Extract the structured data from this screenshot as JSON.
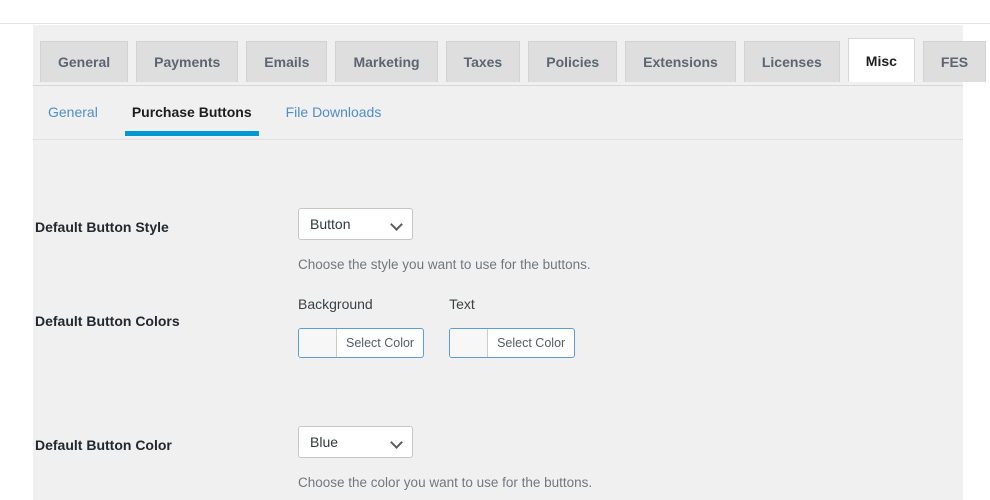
{
  "tabs": [
    {
      "label": "General",
      "active": false
    },
    {
      "label": "Payments",
      "active": false
    },
    {
      "label": "Emails",
      "active": false
    },
    {
      "label": "Marketing",
      "active": false
    },
    {
      "label": "Taxes",
      "active": false
    },
    {
      "label": "Policies",
      "active": false
    },
    {
      "label": "Extensions",
      "active": false
    },
    {
      "label": "Licenses",
      "active": false
    },
    {
      "label": "Misc",
      "active": true
    },
    {
      "label": "FES",
      "active": false
    }
  ],
  "subtabs": [
    {
      "label": "General",
      "active": false
    },
    {
      "label": "Purchase Buttons",
      "active": true
    },
    {
      "label": "File Downloads",
      "active": false
    }
  ],
  "settings": {
    "button_style": {
      "label": "Default Button Style",
      "value": "Button",
      "help": "Choose the style you want to use for the buttons.",
      "chevron_icon": "chevron-down-icon"
    },
    "button_colors": {
      "label": "Default Button Colors",
      "pickers": [
        {
          "caption": "Background",
          "button_label": "Select Color",
          "swatch_color": "#f7f7f7"
        },
        {
          "caption": "Text",
          "button_label": "Select Color",
          "swatch_color": "#f7f7f7"
        }
      ]
    },
    "button_color": {
      "label": "Default Button Color",
      "value": "Blue",
      "help": "Choose the color you want to use for the buttons.",
      "chevron_icon": "chevron-down-icon"
    }
  },
  "colors": {
    "accent_blue": "#0099d3",
    "link_blue": "#4e8ecb",
    "panel_bg": "#f0f0f0",
    "tab_inactive_bg": "#dedede",
    "tab_active_bg": "#ffffff",
    "picker_border": "#5b9dd9"
  }
}
